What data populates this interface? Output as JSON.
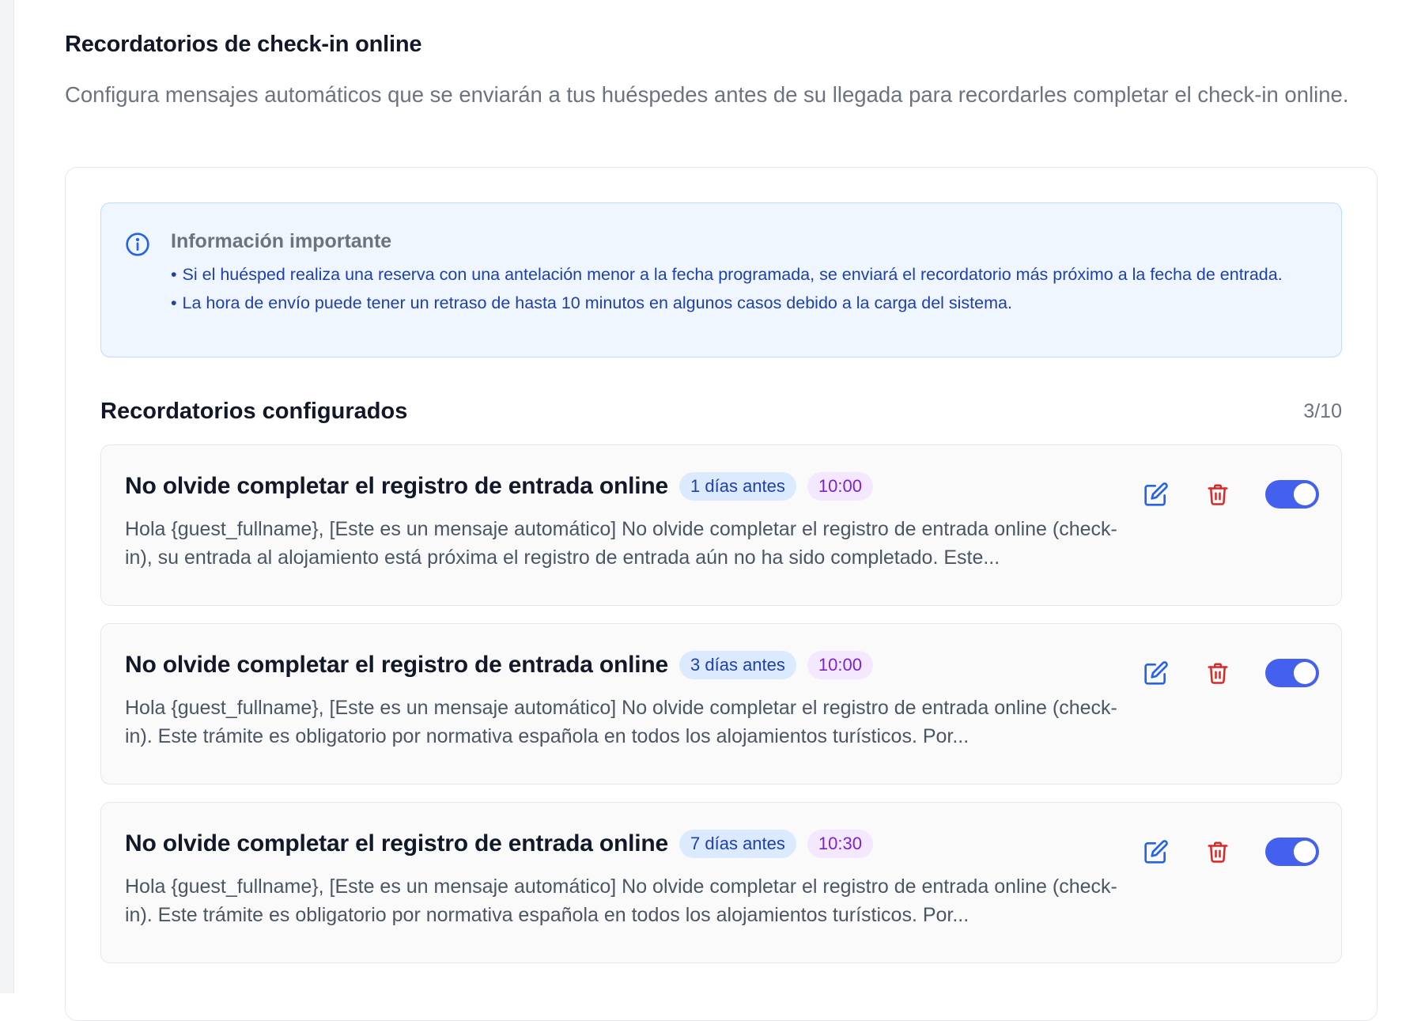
{
  "colors": {
    "accent": "#4361ee",
    "edit_icon": "#2563eb",
    "delete_icon": "#dc2626",
    "info_text": "#1e40af"
  },
  "header": {
    "title": "Recordatorios de check-in online",
    "description": "Configura mensajes automáticos que se enviarán a tus huéspedes antes de su llegada para recordarles completar el check-in online."
  },
  "info": {
    "icon": "info-circle-icon",
    "title": "Información importante",
    "items": [
      "Si el huésped realiza una reserva con una antelación menor a la fecha programada, se enviará el recordatorio más próximo a la fecha de entrada.",
      "La hora de envío puede tener un retraso de hasta 10 minutos en algunos casos debido a la carga del sistema."
    ],
    "bullet": "•"
  },
  "reminders_section": {
    "title": "Recordatorios configurados",
    "count": "3/10"
  },
  "reminders": [
    {
      "title": "No olvide completar el registro de entrada online",
      "days": "1 días antes",
      "time": "10:00",
      "body": "Hola {guest_fullname}, [Este es un mensaje automático] No olvide completar el registro de entrada online (check-in), su entrada al alojamiento está próxima el registro de entrada aún no ha sido completado. Este...",
      "enabled": true
    },
    {
      "title": "No olvide completar el registro de entrada online",
      "days": "3 días antes",
      "time": "10:00",
      "body": "Hola {guest_fullname}, [Este es un mensaje automático] No olvide completar el registro de entrada online (check-in). Este trámite es obligatorio por normativa española en todos los alojamientos turísticos. Por...",
      "enabled": true
    },
    {
      "title": "No olvide completar el registro de entrada online",
      "days": "7 días antes",
      "time": "10:30",
      "body": "Hola {guest_fullname}, [Este es un mensaje automático] No olvide completar el registro de entrada online (check-in). Este trámite es obligatorio por normativa española en todos los alojamientos turísticos. Por...",
      "enabled": true
    }
  ],
  "icons": {
    "edit": "edit-pencil-icon",
    "delete": "trash-icon"
  }
}
